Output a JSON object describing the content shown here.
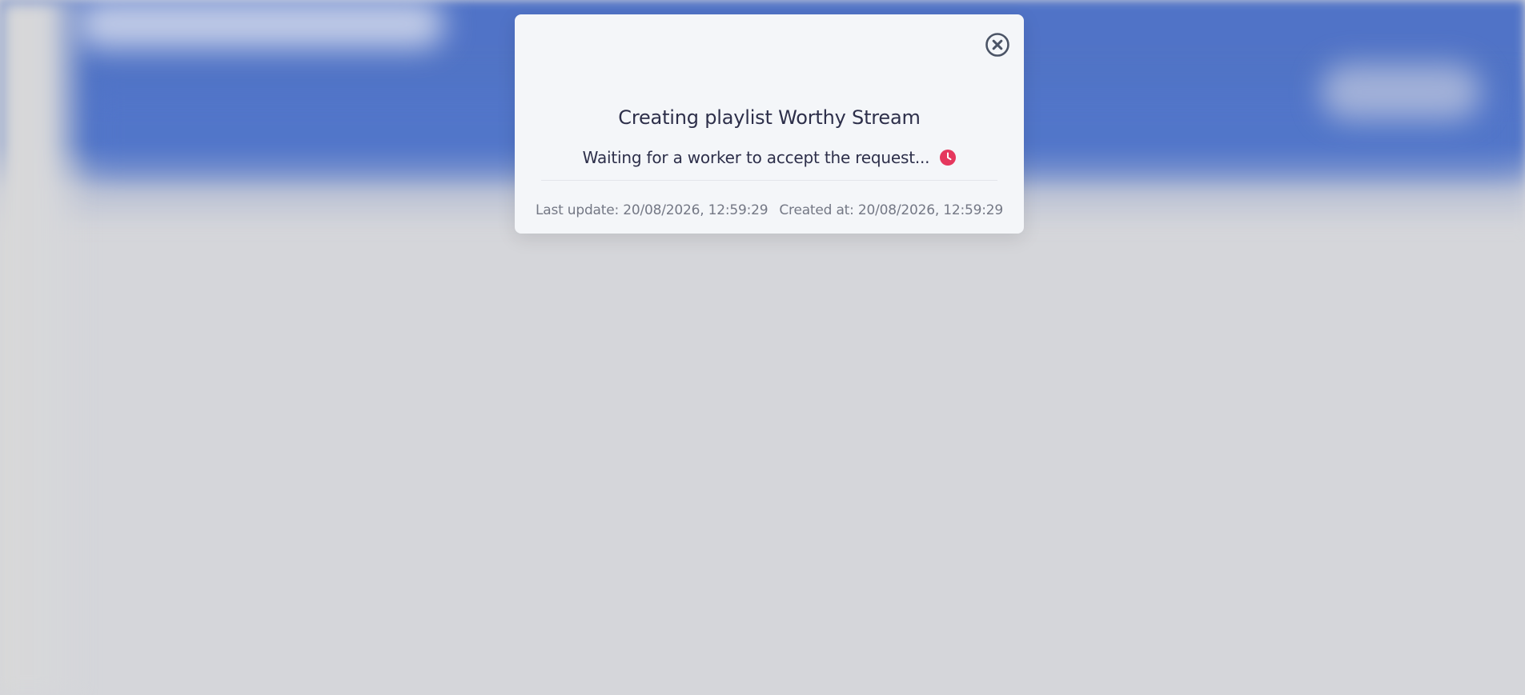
{
  "dialog": {
    "close_icon": "close-circle-icon",
    "title": "Creating playlist Worthy Stream",
    "status_text": "Waiting for a worker to accept the request...",
    "status_icon": "clock-icon",
    "status_color": "#e5375d",
    "last_update": "Last update: 20/08/2026, 12:59:29",
    "created_at": "Created at: 20/08/2026, 12:59:29"
  },
  "colors": {
    "header_blue": "#5073c7",
    "overlay": "#d5d6da",
    "modal_bg": "#f4f6f9",
    "title_text": "#2d2f4a",
    "meta_text": "#747885",
    "close_icon": "#4b5466"
  }
}
